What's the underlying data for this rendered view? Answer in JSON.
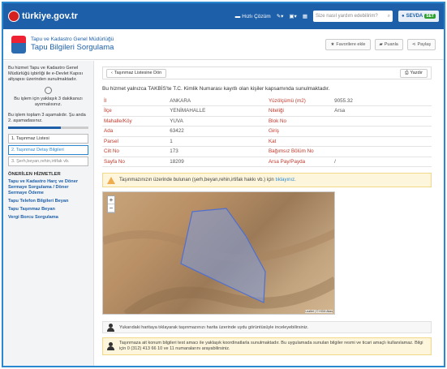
{
  "topbar": {
    "logo": "türkiye.gov.tr",
    "quick_solution": "Hızlı Çözüm",
    "search_placeholder": "Size nasıl yardım edebilirim?",
    "user_name": "SEVDA",
    "user_badge": "SET"
  },
  "header": {
    "agency": "Tapu ve Kadastro Genel Müdürlüğü",
    "title": "Tapu Bilgileri Sorgulama",
    "favorites": "Favorilere ekle",
    "rate": "Puanla",
    "share": "Paylaş"
  },
  "sidebar": {
    "description": "Bu hizmet Tapu ve Kadastro Genel Müdürlüğü işbirliği ile e-Devlet Kapısı altyapısı üzerinden sunulmaktadır.",
    "time_note": "Bu işlem için yaklaşık 3 dakikanızı ayırmalısınız.",
    "steps_note": "Bu işlem toplam 3 aşamalıdır. Şu anda 2. aşamadasınız.",
    "progress": 0.66,
    "steps": [
      "1. Taşınmaz Listesi",
      "2. Taşınmaz Detay Bilgileri",
      "3. Şerh,beyan,rehin,irtifak vb."
    ],
    "suggested_title": "ÖNERİLEN HİZMETLER",
    "suggested": [
      "Tapu ve Kadastro Harç ve Döner Sermaye Sorgulama / Döner Sermaye Ödeme",
      "Tapu Telefon Bilgileri Beyan",
      "Tapu Taşınmaz Beyan",
      "Vergi Borcu Sorgulama"
    ]
  },
  "main": {
    "back_button": "Taşınmaz Listesine Dön",
    "print_button": "Yazdır",
    "intro": "Bu hizmet yalnızca TAKBİS'te T.C. Kimlik Numarası kayıtlı olan kişiler kapsamında sunulmaktadır.",
    "rows": [
      {
        "k1": "İl",
        "v1": "ANKARA",
        "k2": "Yüzölçümü (m2)",
        "v2": "9055.32"
      },
      {
        "k1": "İlçe",
        "v1": "YENİMAHALLE",
        "k2": "Niteliği",
        "v2": "Arsa"
      },
      {
        "k1": "Mahalle/Köy",
        "v1": "YUVA",
        "k2": "Blok No",
        "v2": ""
      },
      {
        "k1": "Ada",
        "v1": "63422",
        "k2": "Giriş",
        "v2": ""
      },
      {
        "k1": "Parsel",
        "v1": "1",
        "k2": "Kat",
        "v2": ""
      },
      {
        "k1": "Cilt No",
        "v1": "173",
        "k2": "Bağımsız Bölüm No",
        "v2": ""
      },
      {
        "k1": "Sayfa No",
        "v1": "18209",
        "k2": "Arsa Pay/Payda",
        "v2": "/"
      }
    ],
    "warning_text": "Taşınmazınızın üzerinde bulunan (şerh,beyan,rehin,irtifak hakkı vb.) için",
    "warning_link": "tıklayınız.",
    "map_attribution": "Leaflet | © HGM Atlas",
    "info1": "Yukarıdaki haritaya tıklayarak taşınmazınızı harita üzerinde uydu görüntüsüyle inceleyebilirsiniz.",
    "info2": "Taşınmaza ait konum bilgileri test amacı ile yaklaşık koordinatlarla sunulmaktadır. Bu uygulamada sunulan bilgiler resmi ve ticari amaçlı kullanılamaz. Bilgi için 0 (312) 413 66 10 ve 11 numaralarını arayabilirsiniz."
  },
  "colors": {
    "brand": "#1d5fa8",
    "key_label": "#c0392b",
    "frame": "#2a88d0"
  }
}
